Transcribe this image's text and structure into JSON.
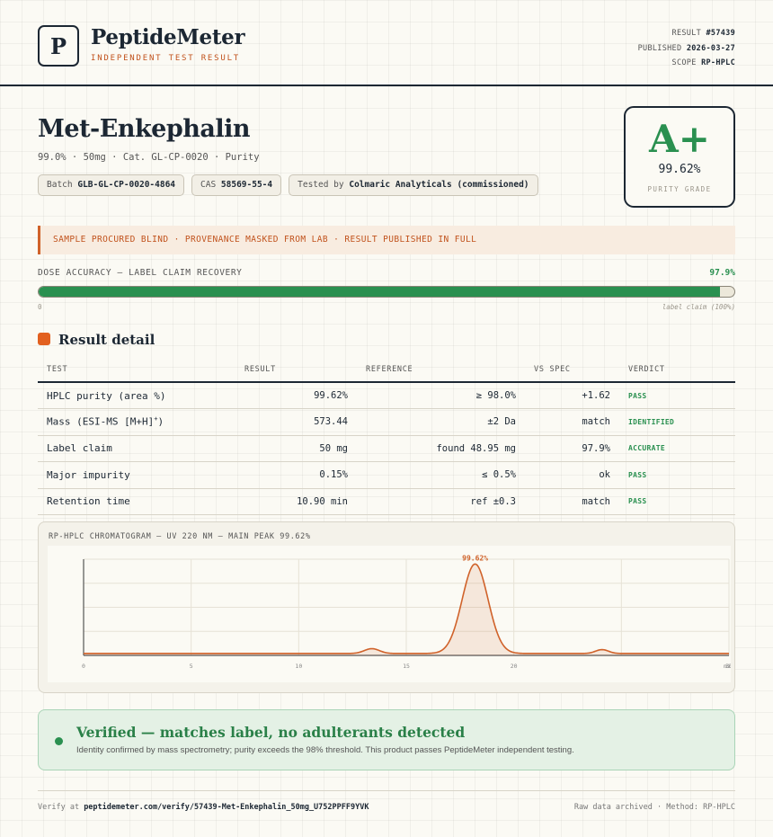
{
  "header": {
    "logo_letter": "P",
    "brand": "PeptideMeter",
    "subtitle": "INDEPENDENT TEST RESULT",
    "result_label": "RESULT",
    "result_value": "#57439",
    "published_label": "PUBLISHED",
    "published_value": "2026-03-27",
    "scope_label": "SCOPE",
    "scope_value": "RP-HPLC"
  },
  "product": {
    "name": "Met-Enkephalin",
    "sub": "99.0% · 50mg · Cat. GL-CP-0020 · Purity",
    "batch_label": "Batch",
    "batch_value": "GLB-GL-CP-0020-4864",
    "cas_label": "CAS",
    "cas_value": "58569-55-4",
    "tested_label": "Tested by",
    "tested_value": "Colmaric Analyticals (commissioned)"
  },
  "grade": {
    "letter": "A+",
    "value": "99.62%",
    "label": "PURITY GRADE",
    "color": "#2a9050"
  },
  "banner": {
    "text": "SAMPLE PROCURED BLIND · PROVENANCE MASKED FROM LAB · RESULT PUBLISHED IN FULL"
  },
  "dose": {
    "label": "DOSE ACCURACY — LABEL CLAIM RECOVERY",
    "pct_text": "97.9%",
    "fraction": 0.979,
    "min_label": "0",
    "max_label": "label claim (100%)"
  },
  "results": {
    "title": "Result detail",
    "headers": [
      "TEST",
      "RESULT",
      "REFERENCE",
      "VS SPEC",
      "VERDICT"
    ],
    "rows": [
      {
        "test": "HPLC purity (area %)",
        "test_sup": "",
        "result": "99.62%",
        "reference": "≥ 98.0%",
        "vs_spec": "+1.62",
        "verdict": "PASS"
      },
      {
        "test": "Mass (ESI-MS [M+H]",
        "test_sup": "+",
        "test_suffix": ")",
        "result": "573.44",
        "reference": "±2 Da",
        "vs_spec": "match",
        "verdict": "IDENTIFIED"
      },
      {
        "test": "Label claim",
        "test_sup": "",
        "result": "50 mg",
        "reference": "found 48.95 mg",
        "vs_spec": "97.9%",
        "verdict": "ACCURATE"
      },
      {
        "test": "Major impurity",
        "test_sup": "",
        "result": "0.15%",
        "reference": "≤ 0.5%",
        "vs_spec": "ok",
        "verdict": "PASS"
      },
      {
        "test": "Retention time",
        "test_sup": "",
        "result": "10.90 min",
        "reference": "ref ±0.3",
        "vs_spec": "match",
        "verdict": "PASS"
      }
    ]
  },
  "chart": {
    "title": "RP-HPLC CHROMATOGRAM — UV 220 NM — MAIN PEAK 99.62%"
  },
  "chart_data": {
    "type": "line",
    "title": "RP-HPLC CHROMATOGRAM — UV 220 NM — MAIN PEAK 99.62%",
    "xlabel": "",
    "ylabel": "",
    "xlim": [
      0,
      30
    ],
    "x_ticks": [
      "0",
      "5",
      "10",
      "15",
      "20",
      "",
      "30"
    ],
    "x_tick_values": [
      0,
      5,
      10,
      15,
      20,
      25,
      30
    ],
    "xmax_label": "min",
    "baseline": 0.02,
    "peaks": [
      {
        "center": 13.4,
        "height": 0.05,
        "width": 0.35
      },
      {
        "center": 18.2,
        "height": 0.93,
        "width": 0.6,
        "label": "99.62%"
      },
      {
        "center": 24.1,
        "height": 0.04,
        "width": 0.3
      }
    ],
    "ylim": [
      0,
      1.0
    ],
    "grid": true,
    "color": "#d0622a"
  },
  "verified": {
    "title": "Verified — matches label, no adulterants detected",
    "sub": "Identity confirmed by mass spectrometry; purity exceeds the 98% threshold. This product passes PeptideMeter independent testing."
  },
  "footer": {
    "verify_prefix": "Verify at",
    "verify_url": "peptidemeter.com/verify/57439-Met-Enkephalin_50mg_U752PPFF9YVK",
    "right": "Raw data archived · Method: RP-HPLC"
  }
}
